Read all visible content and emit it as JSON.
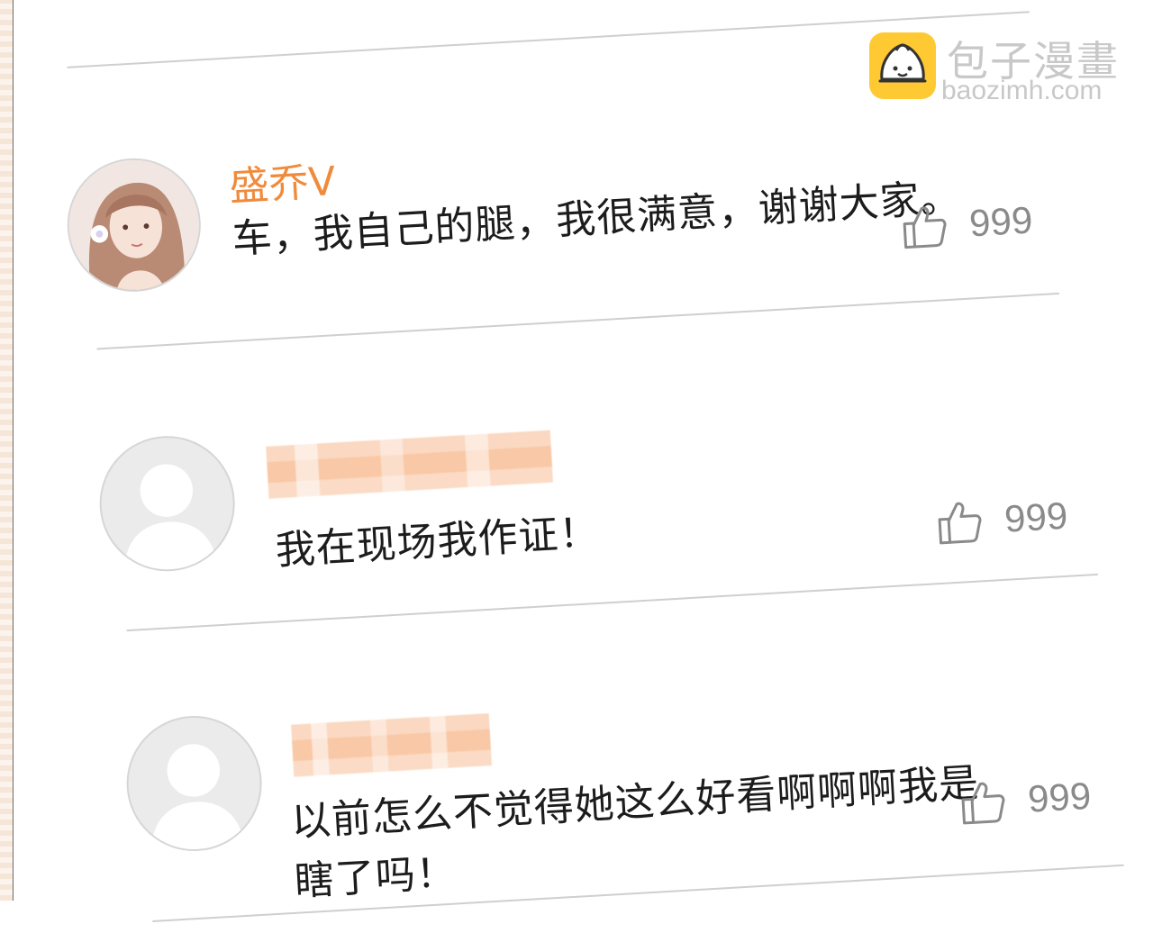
{
  "watermark": {
    "name": "包子漫畫",
    "domain": "baozimh.com"
  },
  "comments": [
    {
      "username": "盛乔V",
      "text": "车，我自己的腿，我很满意，谢谢大家。",
      "likes": "999",
      "avatar": "illustrated-girl-avatar"
    },
    {
      "username_blurred": true,
      "text": "我在现场我作证！",
      "likes": "999",
      "avatar": "default-user-avatar"
    },
    {
      "username_blurred": true,
      "text_line1": "以前怎么不觉得她这么好看啊啊啊我是",
      "text_line2": "瞎了吗！",
      "likes": "999",
      "avatar": "default-user-avatar"
    }
  ],
  "colors": {
    "username": "#f08b3c",
    "divider": "#cfcfcf",
    "like": "#8a8a8a",
    "logo": "#ffc933"
  }
}
